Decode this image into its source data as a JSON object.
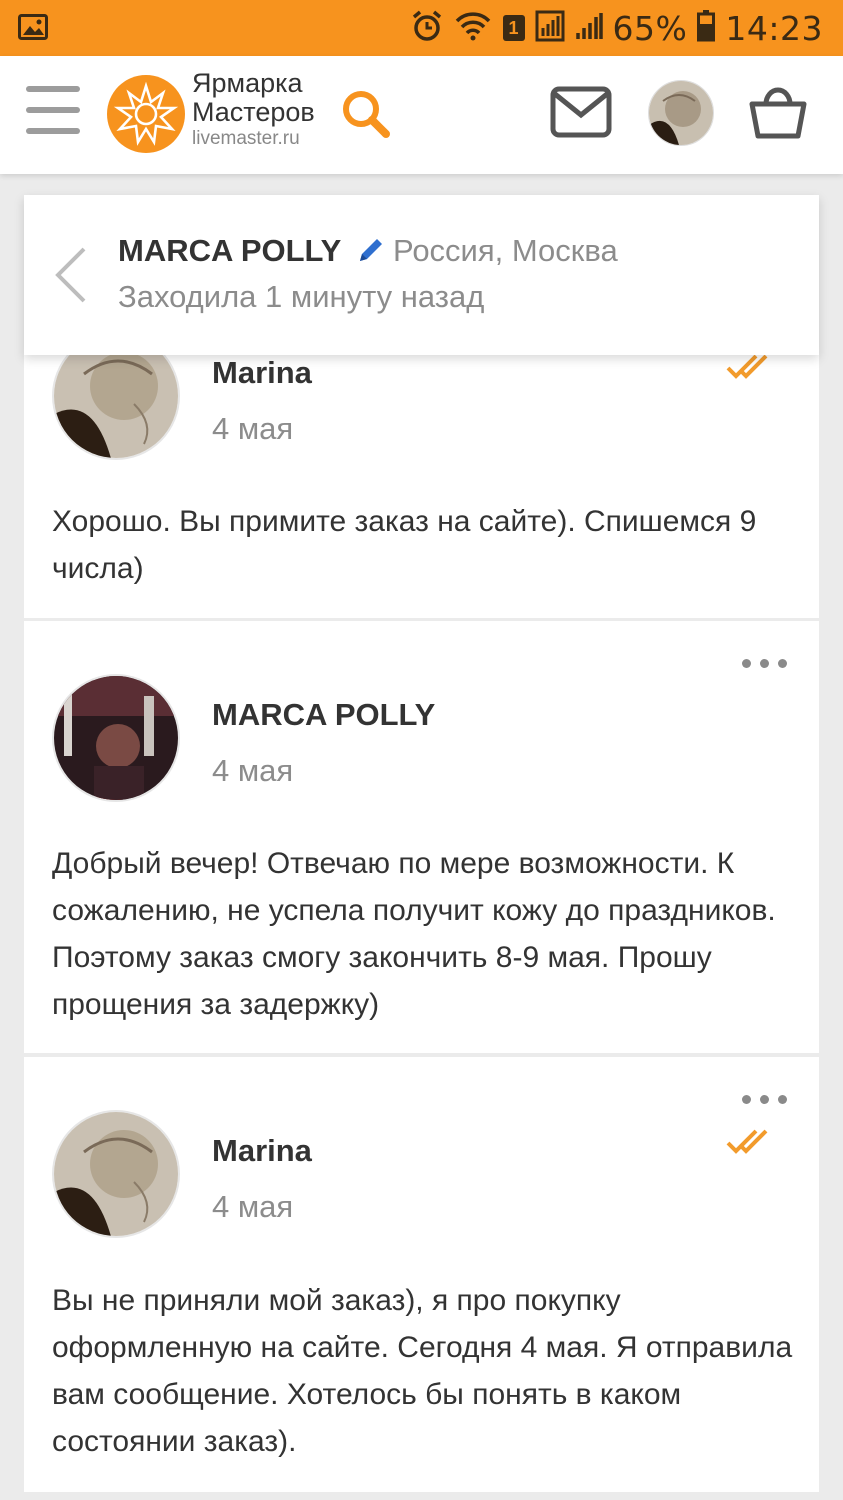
{
  "status_bar": {
    "battery": "65%",
    "time": "14:23",
    "sim_slot": "1",
    "icons": [
      "gallery-icon",
      "alarm-icon",
      "wifi-icon",
      "sim-icon",
      "signal-icon",
      "battery-icon"
    ]
  },
  "header": {
    "logo_line1": "Ярмарка",
    "logo_line2": "Мастеров",
    "logo_domain": "livemaster.ru",
    "icons": [
      "menu-icon",
      "sunburst-logo-icon",
      "search-icon",
      "mail-icon",
      "avatar",
      "cart-icon"
    ]
  },
  "conversation": {
    "user_name": "MARCA POLLY",
    "location": "Россия, Москва",
    "last_seen": "Заходила 1 минуту назад"
  },
  "messages": [
    {
      "author": "Marina",
      "date": "4 мая",
      "text": "Хорошо. Вы примите заказ на сайте). Спишемся 9 числа)",
      "read": true
    },
    {
      "author": "MARCA POLLY",
      "date": "4 мая",
      "text": "Добрый вечер! Отвечаю по мере возможности. К сожалению, не успела получит кожу до праздников. Поэтому заказ смогу закончить 8-9 мая. Прошу прощения за задержку)",
      "read": false
    },
    {
      "author": "Marina",
      "date": "4 мая",
      "text": "Вы не приняли мой заказ), я про покупку оформленную на сайте. Сегодня 4 мая. Я отправила вам сообщение. Хотелось бы понять в каком состоянии заказ).",
      "read": true
    }
  ],
  "colors": {
    "brand_orange": "#f7931e",
    "check_orange": "#f29b2c",
    "pencil_blue": "#2f6fcf"
  }
}
